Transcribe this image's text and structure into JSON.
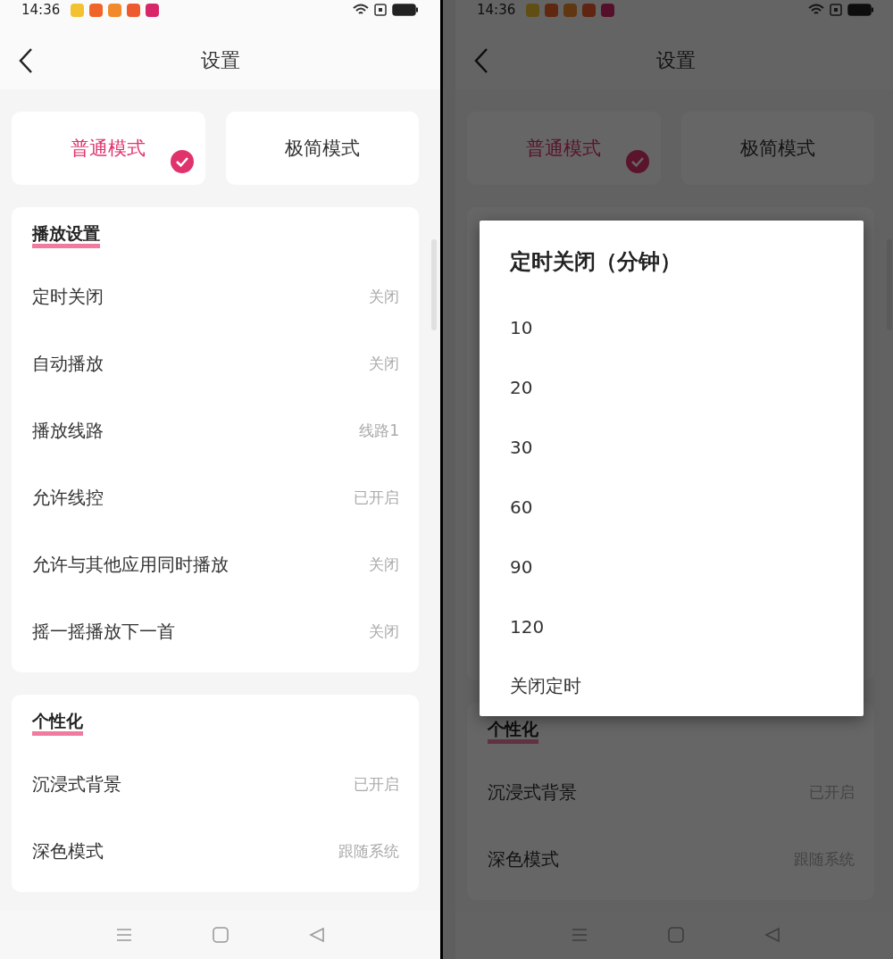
{
  "screens": [
    {
      "status_bar": {
        "time": "14:36"
      },
      "header": {
        "title": "设置"
      },
      "modes": [
        {
          "label": "普通模式",
          "selected": true
        },
        {
          "label": "极简模式",
          "selected": false
        }
      ],
      "sections": [
        {
          "title": "播放设置",
          "items": [
            {
              "label": "定时关闭",
              "value": "关闭"
            },
            {
              "label": "自动播放",
              "value": "关闭"
            },
            {
              "label": "播放线路",
              "value": "线路1"
            },
            {
              "label": "允许线控",
              "value": "已开启"
            },
            {
              "label": "允许与其他应用同时播放",
              "value": "关闭"
            },
            {
              "label": "摇一摇播放下一首",
              "value": "关闭"
            }
          ]
        },
        {
          "title": "个性化",
          "items": [
            {
              "label": "沉浸式背景",
              "value": "已开启"
            },
            {
              "label": "深色模式",
              "value": "跟随系统"
            }
          ]
        }
      ]
    },
    {
      "status_bar": {
        "time": "14:36"
      },
      "header": {
        "title": "设置"
      },
      "modes": [
        {
          "label": "普通模式",
          "selected": true
        },
        {
          "label": "极简模式",
          "selected": false
        }
      ],
      "sections": [
        {
          "title": "个性化",
          "items": [
            {
              "label": "沉浸式背景",
              "value": "已开启"
            },
            {
              "label": "深色模式",
              "value": "跟随系统"
            }
          ]
        }
      ],
      "dialog": {
        "title": "定时关闭（分钟）",
        "options": [
          "10",
          "20",
          "30",
          "60",
          "90",
          "120",
          "关闭定时"
        ]
      }
    }
  ]
}
